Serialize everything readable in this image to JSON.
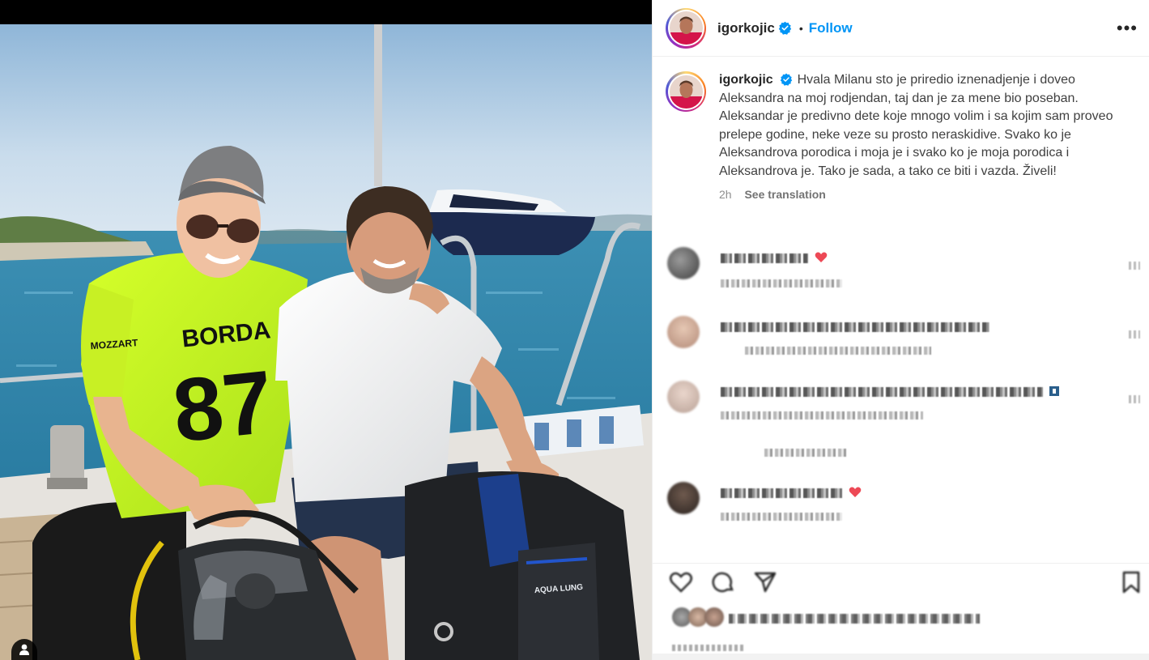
{
  "post": {
    "username": "igorkojic",
    "follow_label": "Follow",
    "separator": "•",
    "more_label": "•••",
    "caption": "Hvala Milanu sto je priredio iznenadjenje i doveo Aleksandra na moj rodjendan, taj dan je za mene bio poseban. Aleksandar je predivno dete koje mnogo volim i sa kojim sam proveo prelepe godine, neke veze su prosto neraskidive. Svako ko je Aleksandrova porodica i moja je i svako ko je moja porodica i Aleksandrova je. Tako je sada, a tako ce biti i vazda. Živeli!",
    "time_ago": "2h",
    "see_translation": "See translation"
  },
  "photo": {
    "jersey_brand": "BORDA",
    "jersey_number": "87",
    "sponsor": "MOZZART",
    "gear_brand": "AQUA LUNG"
  },
  "colors": {
    "accent": "#0095f6",
    "verified": "#0095f6",
    "heart": "#ed4956"
  },
  "icons": {
    "verified": "verified-badge-icon",
    "like": "heart-icon",
    "comment": "comment-bubble-icon",
    "share": "paper-plane-icon",
    "save": "bookmark-icon",
    "tagged": "person-tag-icon"
  }
}
